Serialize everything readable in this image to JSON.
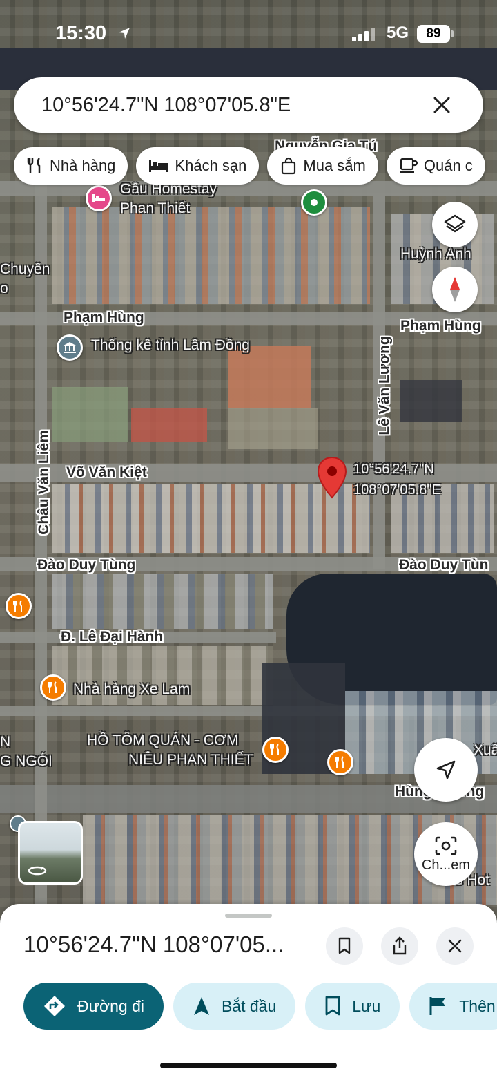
{
  "status_bar": {
    "time": "15:30",
    "network": "5G",
    "battery": "89"
  },
  "search": {
    "query": "10°56'24.7\"N 108°07'05.8\"E"
  },
  "chips": [
    {
      "label": "Nhà hàng",
      "icon": "restaurant-icon"
    },
    {
      "label": "Khách sạn",
      "icon": "hotel-icon"
    },
    {
      "label": "Mua sắm",
      "icon": "shopping-bag-icon"
    },
    {
      "label": "Quán c",
      "icon": "coffee-icon"
    }
  ],
  "map": {
    "streets": {
      "nguyen_gia_tu_top": "Nguyễn Gia Tú",
      "nguyen_gia_tu_left": "Nguyễn Gia Tú",
      "pham_hung_left": "Phạm Hùng",
      "pham_hung_right": "Phạm Hùng",
      "le_van_luong": "Lê Văn Lương",
      "chau_van_liem": "Châu Văn Liêm",
      "vo_van_kiet": "Võ Văn Kiệt",
      "dao_duy_tung_left": "Đào Duy Tùng",
      "dao_duy_tung_right": "Đào Duy Tùn",
      "le_dai_hanh": "Đ. Lê Đại Hành",
      "hung_vuong": "Hùng Vương"
    },
    "pois": {
      "homestay_line1": "Gâu Homestay",
      "homestay_line2": "Phan Thiết",
      "thong_ke": "Thống kê tỉnh Lâm Đồng",
      "huynh_anh": "Huỳnh Anh",
      "chuyen_line1": "Chuyên",
      "chuyen_line2": "o",
      "xe_lam": "Nhà hàng Xe Lam",
      "ho_tom_line1": "HỒ TÔM QUÁN - CƠM",
      "ho_tom_line2": "NIÊU PHAN THIẾT",
      "ngoi_line1": "N",
      "ngoi_line2": "G NGÓI",
      "xua": "Xuâ",
      "hotel_bottom": "s Hot"
    },
    "pin_label_line1": "10°56'24.7\"N",
    "pin_label_line2": "108°07'05.8\"E",
    "colors": {
      "pin": "#e53935",
      "poi_restaurant": "#f57c00",
      "poi_hotel": "#e5488a",
      "poi_gov": "#607d8b",
      "poi_park": "#1e8e3e"
    }
  },
  "lens_button": {
    "label": "Ch...em"
  },
  "sheet": {
    "title": "10°56'24.7\"N 108°07'05...",
    "actions": [
      {
        "label": "Đường đi",
        "icon": "directions-icon"
      },
      {
        "label": "Bắt đầu",
        "icon": "navigation-arrow-icon"
      },
      {
        "label": "Lưu",
        "icon": "bookmark-icon"
      },
      {
        "label": "Thên",
        "icon": "flag-icon"
      }
    ]
  }
}
